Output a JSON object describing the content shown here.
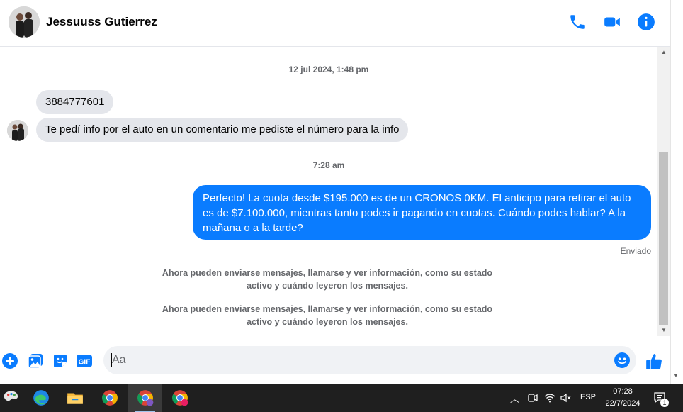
{
  "header": {
    "contact_name": "Jessuuss Gutierrez",
    "icons": [
      "phone-icon",
      "video-icon",
      "info-icon"
    ],
    "accent_color": "#0a7cff"
  },
  "messages": {
    "timestamp_1": "12 jul 2024, 1:48 pm",
    "incoming_1": "3884777601",
    "incoming_2": "Te pedí info por el auto en un comentario me pediste el número para la info",
    "timestamp_2": "7:28 am",
    "outgoing_1": "Perfecto! La cuota desde $195.000 es de un CRONOS 0KM. El anticipo para retirar el auto es de $7.100.000, mientras tanto podes ir pagando en cuotas. Cuándo podes hablar? A la mañana o a la tarde?",
    "status": "Enviado",
    "system_1": "Ahora pueden enviarse mensajes, llamarse y ver información, como su estado activo y cuándo leyeron los mensajes.",
    "system_2": "Ahora pueden enviarse mensajes, llamarse y ver información, como su estado activo y cuándo leyeron los mensajes."
  },
  "composer": {
    "placeholder": "Aa",
    "icons": [
      "plus-icon",
      "gallery-icon",
      "sticker-icon",
      "gif-icon",
      "emoji-icon",
      "like-icon"
    ],
    "gif_label": "GIF"
  },
  "taskbar": {
    "apps": [
      "paint-icon",
      "edge-icon",
      "file-explorer-icon",
      "chrome-icon",
      "chrome-profile-icon",
      "chrome-profile-c-icon"
    ],
    "language": "ESP",
    "time": "07:28",
    "date": "22/7/2024",
    "notification_count": "1"
  }
}
